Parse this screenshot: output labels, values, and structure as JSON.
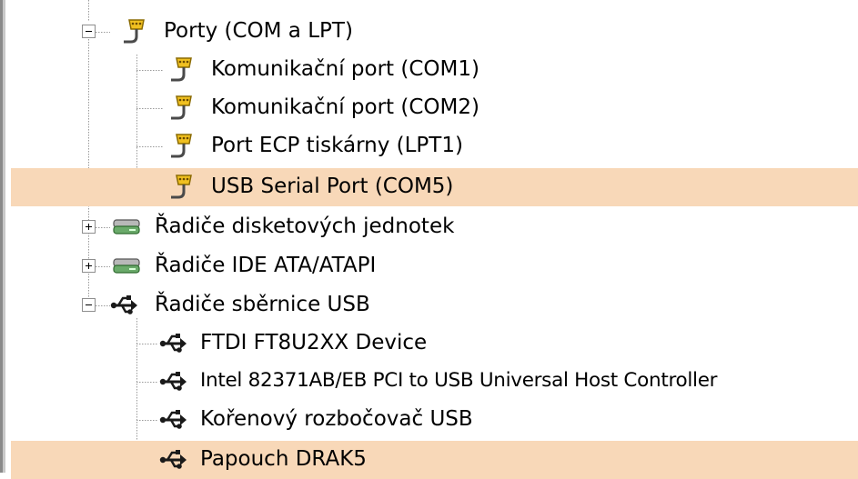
{
  "tree": {
    "ports": {
      "label": "Porty (COM a LPT)",
      "expanded": true,
      "icon": "port-connector-icon",
      "children": [
        {
          "label": "Komunikační port (COM1)",
          "icon": "port-connector-icon"
        },
        {
          "label": "Komunikační port (COM2)",
          "icon": "port-connector-icon"
        },
        {
          "label": "Port ECP tiskárny (LPT1)",
          "icon": "port-connector-icon"
        },
        {
          "label": "USB Serial Port (COM5)",
          "icon": "port-connector-icon",
          "highlighted": true
        }
      ]
    },
    "floppy_controllers": {
      "label": "Řadiče disketových jednotek",
      "expanded": false,
      "icon": "drive-controller-icon"
    },
    "ide_controllers": {
      "label": "Řadiče IDE ATA/ATAPI",
      "expanded": false,
      "icon": "drive-controller-icon"
    },
    "usb_controllers": {
      "label": "Řadiče sběrnice USB",
      "expanded": true,
      "icon": "usb-icon",
      "children": [
        {
          "label": "FTDI FT8U2XX Device",
          "icon": "usb-icon"
        },
        {
          "label": "Intel 82371AB/EB PCI to USB Universal Host Controller",
          "icon": "usb-icon"
        },
        {
          "label": "Kořenový rozbočovač USB",
          "icon": "usb-icon"
        },
        {
          "label": "Papouch DRAK5",
          "icon": "usb-icon",
          "highlighted": true
        }
      ]
    }
  },
  "colors": {
    "highlight": "#f8d8b8",
    "tree_lines": "#9a9a9a",
    "port_icon": "#f0c020",
    "usb_icon": "#1a1a1a",
    "drive_icon": "#5a9a5a"
  }
}
